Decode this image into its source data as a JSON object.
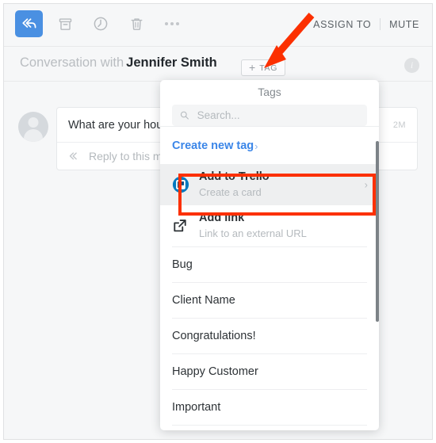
{
  "toolbar": {
    "buttons": [
      {
        "name": "reply-all",
        "icon": "reply-all-icon",
        "active": true
      },
      {
        "name": "archive",
        "icon": "archive-icon",
        "active": false
      },
      {
        "name": "snooze",
        "icon": "clock-icon",
        "active": false
      },
      {
        "name": "delete",
        "icon": "trash-icon",
        "active": false
      },
      {
        "name": "more",
        "icon": "more-horizontal-icon",
        "active": false
      }
    ],
    "assign_to_label": "ASSIGN TO",
    "mute_label": "MUTE"
  },
  "conversation": {
    "prefix": "Conversation with",
    "contact_name": "Jennifer Smith",
    "tag_button": {
      "plus": "+",
      "label": "TAG"
    },
    "info_icon_glyph": "i",
    "message": {
      "text": "What are your hours? Can I schedule an appointment?",
      "timestamp": "2M",
      "reply_placeholder": "Reply to this message..."
    }
  },
  "tags_panel": {
    "title": "Tags",
    "search": {
      "placeholder": "Search...",
      "value": ""
    },
    "create_new_tag": {
      "label": "Create new tag",
      "chevron": "›"
    },
    "actions": [
      {
        "title": "Add to Trello",
        "subtitle": "Create a card",
        "icon": "trello-icon",
        "chevron": "›",
        "selected": true
      },
      {
        "title": "Add link",
        "subtitle": "Link to an external URL",
        "icon": "external-link-icon",
        "chevron": "",
        "selected": false
      }
    ],
    "tags": [
      {
        "label": "Bug"
      },
      {
        "label": "Client Name"
      },
      {
        "label": "Congratulations!"
      },
      {
        "label": "Happy Customer"
      },
      {
        "label": "Important"
      }
    ]
  },
  "annotations": {
    "arrow_color": "#fc3000",
    "highlight_color": "#fc3000"
  },
  "colors": {
    "accent_blue": "#4a90e2",
    "link_blue": "#3b86e8",
    "trello_blue": "#0079bf",
    "page_bg": "#f6f7f8"
  }
}
